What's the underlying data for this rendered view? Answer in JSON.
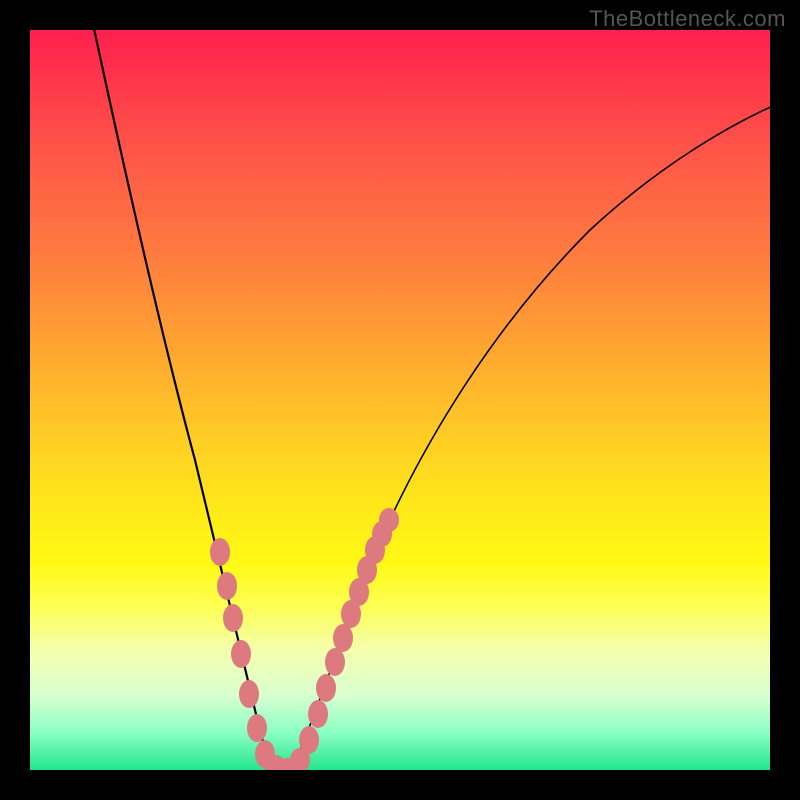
{
  "watermark": "TheBottleneck.com",
  "colors": {
    "frame": "#000000",
    "curve": "#000000",
    "marker": "#dd7a80",
    "gradient_top": "#ff1f4f",
    "gradient_bottom": "#22e68c"
  },
  "chart_data": {
    "type": "line",
    "title": "",
    "xlabel": "",
    "ylabel": "",
    "xlim": [
      0,
      100
    ],
    "ylim": [
      0,
      100
    ],
    "x": [
      0,
      3,
      6,
      9,
      12,
      15,
      18,
      20,
      22,
      24,
      26,
      28,
      30,
      31,
      32,
      33,
      34,
      36,
      38,
      40,
      43,
      46,
      50,
      55,
      60,
      66,
      72,
      80,
      90,
      100
    ],
    "series": [
      {
        "name": "bottleneck_curve",
        "values": [
          110,
          98,
          86,
          75,
          64,
          54,
          44,
          38,
          31,
          25,
          19,
          13,
          6,
          2,
          0,
          0,
          0,
          3,
          8,
          13,
          20,
          27,
          35,
          44,
          52,
          60,
          67,
          75,
          83,
          90
        ]
      }
    ],
    "minimum_x_range": [
      31,
      34
    ],
    "marker_points": [
      {
        "x": 25.5,
        "y": 30
      },
      {
        "x": 26.5,
        "y": 24
      },
      {
        "x": 27.5,
        "y": 21
      },
      {
        "x": 28.5,
        "y": 15
      },
      {
        "x": 29.5,
        "y": 9
      },
      {
        "x": 30.5,
        "y": 4
      },
      {
        "x": 31.5,
        "y": 1
      },
      {
        "x": 32.5,
        "y": 0
      },
      {
        "x": 33.5,
        "y": 0
      },
      {
        "x": 34.5,
        "y": 1
      },
      {
        "x": 35.5,
        "y": 3
      },
      {
        "x": 36.5,
        "y": 5
      },
      {
        "x": 37.5,
        "y": 8
      },
      {
        "x": 38.5,
        "y": 11
      },
      {
        "x": 39.5,
        "y": 14
      },
      {
        "x": 40.5,
        "y": 17
      },
      {
        "x": 41.5,
        "y": 20
      },
      {
        "x": 42.5,
        "y": 23
      },
      {
        "x": 43.5,
        "y": 26
      },
      {
        "x": 44.5,
        "y": 29
      },
      {
        "x": 45.5,
        "y": 31
      }
    ]
  }
}
